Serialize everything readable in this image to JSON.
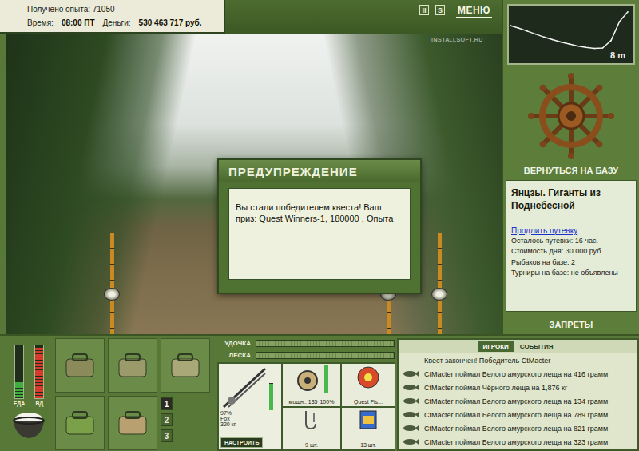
{
  "stats": {
    "experience": "Получено опыта: 71050",
    "time_label": "Время:",
    "time": "08:00 ПТ",
    "money_label": "Деньги:",
    "money": "530 463 717 руб."
  },
  "toolbar": {
    "pause": "II",
    "sound": "S",
    "menu": "МЕНЮ"
  },
  "watermark": "INSTALLSOFT.RU",
  "dialog": {
    "title": "ПРЕДУПРЕЖДЕНИЕ",
    "message": "Вы стали победителем квеста! Ваш приз: Quest Winners-1, 180000 , Опыта"
  },
  "depth_chart": {
    "reading": "8 m",
    "max": 10,
    "profile": [
      3.4,
      3.9,
      4.5,
      5.1,
      5.7,
      6.2,
      6.7,
      7.1,
      7.5,
      7.8,
      8.0,
      7.9,
      6.4,
      2.6,
      0.6
    ]
  },
  "base": {
    "return": "ВЕРНУТЬСЯ НА БАЗУ",
    "title": "Янцзы. Гиганты из Поднебесной",
    "extend": "Продлить путевку",
    "lines": [
      "Осталось путевки: 16 час.",
      "Стоимость дня: 30 000 руб.",
      "Рыбаков на базе: 2",
      "Турниры на базе: не объявлены"
    ],
    "bans": "ЗАПРЕТЫ"
  },
  "meters": [
    {
      "label": "ЕДА",
      "level": 0.3,
      "color": "#3fae3f"
    },
    {
      "label": "ВД",
      "level": 0.95,
      "color": "#d83a2a"
    }
  ],
  "pages": [
    {
      "label": "1",
      "selected": true
    },
    {
      "label": "2",
      "selected": false
    },
    {
      "label": "3",
      "selected": false
    }
  ],
  "bars": [
    {
      "label": "УДОЧКА",
      "level": 0
    },
    {
      "label": "ЛЕСКА",
      "level": 0
    }
  ],
  "tackle": {
    "rod": {
      "name": "Fox",
      "strength": "320 кг",
      "wear": "97%",
      "level": 0.97
    },
    "reel": {
      "label": "мощн.: 135",
      "wear": "100%",
      "level": 1
    },
    "line": {
      "label": "Quest Fis..."
    },
    "hook": {
      "count": "9 шт."
    },
    "bait": {
      "count": "13 шт."
    },
    "setup": "НАСТРОИТЬ"
  },
  "feed": {
    "tabs": [
      {
        "label": "ИГРОКИ",
        "selected": true
      },
      {
        "label": "СОБЫТИЯ",
        "selected": false
      }
    ],
    "rows": [
      {
        "kind": "notice",
        "text": "Квест закончен! Победитель CtMacter"
      },
      {
        "kind": "catch",
        "text": "CtMacter поймал Белого амурского леща на 416 грамм"
      },
      {
        "kind": "catch",
        "text": "CtMacter поймал Чёрного леща на 1,876 кг"
      },
      {
        "kind": "catch",
        "text": "CtMacter поймал Белого амурского леща на 134 грамм"
      },
      {
        "kind": "catch",
        "text": "CtMacter поймал Белого амурского леща на 789 грамм"
      },
      {
        "kind": "catch",
        "text": "CtMacter поймал Белого амурского леща на 821 грамм"
      },
      {
        "kind": "catch",
        "text": "CtMacter поймал Белого амурского леща на 323 грамм"
      }
    ]
  }
}
